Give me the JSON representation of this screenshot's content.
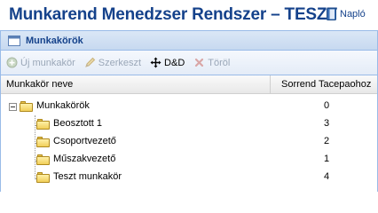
{
  "header": {
    "title": "Munkarend Menedzser Rendszer – TESZT",
    "naplo_label": "Napló"
  },
  "panel": {
    "title": "Munkakörök"
  },
  "toolbar": {
    "new_label": "Új munkakör",
    "edit_label": "Szerkeszt",
    "dd_label": "D&D",
    "delete_label": "Töröl"
  },
  "grid": {
    "columns": {
      "name": "Munkakör neve",
      "order": "Sorrend Tacepaohoz"
    },
    "root": {
      "name": "Munkakörök",
      "order": "0"
    },
    "children": [
      {
        "name": "Beosztott 1",
        "order": "3"
      },
      {
        "name": "Csoportvezető",
        "order": "2"
      },
      {
        "name": "Műszakvezető",
        "order": "1"
      },
      {
        "name": "Teszt munkakör",
        "order": "4"
      }
    ]
  },
  "icons": {
    "naplo": "book-icon",
    "panel": "window-icon",
    "new": "add-icon",
    "edit": "pencil-icon",
    "dd": "move-arrows-icon",
    "delete": "delete-icon",
    "folder": "folder-icon",
    "expander": "collapse-icon"
  },
  "colors": {
    "title": "#15428b",
    "panel_border": "#99bbe8",
    "disabled_text": "#9aa7b8",
    "folder": "#f1cf59"
  }
}
